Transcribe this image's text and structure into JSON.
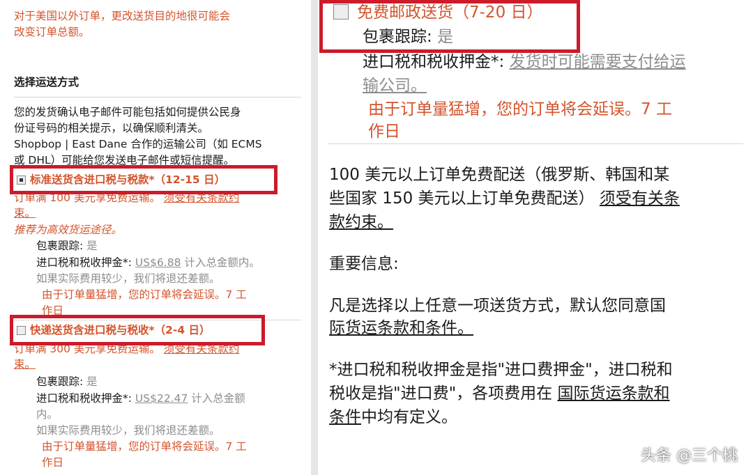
{
  "left": {
    "note": [
      "对于美国以外订单，更改送货目的地很可能会",
      "改变订单总额。"
    ],
    "section_title": "选择运送方式",
    "description": [
      "您的发货确认电子邮件可能包括如何提供公民身",
      "份证号码的相关提示，以确保顺利清关。",
      "Shopbop | East Dane 合作的运输公司（如 ECMS",
      "或 DHL）可能给您发送电子邮件或短信提醒。"
    ],
    "options": [
      {
        "label": "标准送货含进口税与税款*（12-15 日）",
        "checked": true,
        "promo": [
          "订单满 100 美元享免费运输。",
          "须受有关条款约",
          "束。"
        ],
        "recommend": "推荐为高效货运途径。",
        "tracking_label": "包裹跟踪:",
        "tracking_value": "是",
        "duty_label": "进口税和税收押金*:",
        "duty_amount": "US$6.88",
        "duty_suffix": "计入总金额内。",
        "refund": "如果实际费用较少，我们将退还差额。",
        "delay": [
          "由于订单量猛增，您的订单将会延误。7 工",
          "作日"
        ]
      },
      {
        "label": "快递送货含进口税与税收*（2-4 日）",
        "checked": false,
        "promo": [
          "订单满 300 美元享免费运输。",
          "须受有关条款约",
          "束。"
        ],
        "tracking_label": "包裹跟踪:",
        "tracking_value": "是",
        "duty_label": "进口税和税收押金*:",
        "duty_amount": "US$22.47",
        "duty_suffix": "计入总金额",
        "duty_suffix2": "内。",
        "refund": "如果实际费用较少，我们将退还差额。",
        "delay": [
          "由于订单量猛增，您的订单将会延误。7 工",
          "作日"
        ]
      }
    ]
  },
  "right": {
    "option": {
      "label": "免费邮政送货（7-20 日）",
      "tracking_label": "包裹跟踪:",
      "tracking_value": "是",
      "duty_label": "进口税和税收押金*:",
      "duty_link": [
        "发货时可能需要支付给运",
        "输公司。"
      ],
      "delay": [
        "由于订单量猛增，您的订单将会延误。7 工",
        "作日"
      ]
    },
    "free_shipping": [
      "100 美元以上订单免费配送（俄罗斯、韩国和某",
      "些国家 150 美元以上订单免费配送）",
      "须受有关条",
      "款约束。"
    ],
    "important_title": "重要信息:",
    "agree": [
      "凡是选择以上任意一项送货方式，默认您同意国",
      "际货运条款和条件。"
    ],
    "definition": [
      "*进口税和税收押金是指\"进口费押金\"，进口税和",
      "税收是指\"进口费\"，各项费用在",
      "国际货运条款和",
      "条件",
      "中均有定义。"
    ]
  },
  "watermark": "头条 @三个桃",
  "colors": {
    "accent_red": "#d4532b",
    "highlight_box": "#cc1b2b"
  }
}
